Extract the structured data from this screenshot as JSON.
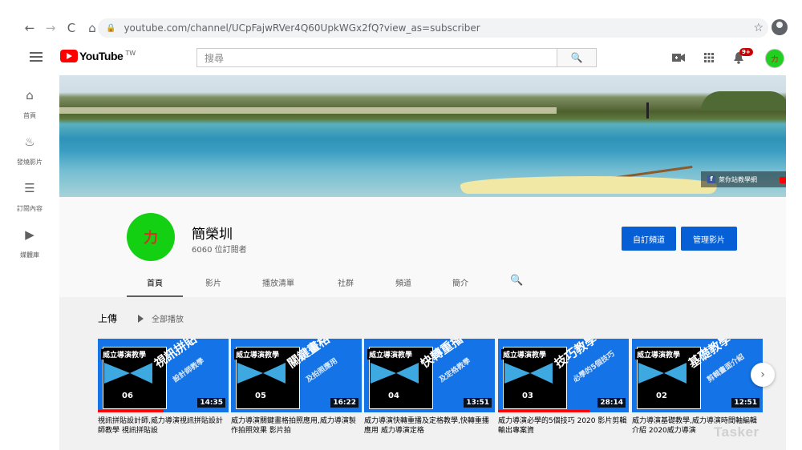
{
  "browser": {
    "url": "youtube.com/channel/UCpFajwRVer4Q60UpkWGx2fQ?view_as=subscriber",
    "back": "←",
    "forward": "→",
    "reload": "C",
    "home": "⌂",
    "star": "☆"
  },
  "header": {
    "logo_text": "YouTube",
    "region": "TW",
    "search_placeholder": "搜尋",
    "notification_count": "9+",
    "avatar_text": "力"
  },
  "sidebar": {
    "items": [
      {
        "label": "首頁",
        "icon": "home-icon",
        "glyph": "⌂"
      },
      {
        "label": "發燒影片",
        "icon": "flame-icon",
        "glyph": "♨"
      },
      {
        "label": "訂閱內容",
        "icon": "subscriptions-icon",
        "glyph": "☰"
      },
      {
        "label": "媒體庫",
        "icon": "library-icon",
        "glyph": "▶"
      }
    ]
  },
  "banner": {
    "link_text": "萊你站教學網"
  },
  "channel": {
    "name": "簡榮圳",
    "subscribers": "6060 位訂閱者",
    "avatar_text": "力",
    "customize_button": "自訂頻道",
    "manage_button": "管理影片",
    "tabs": [
      "首頁",
      "影片",
      "播放清單",
      "社群",
      "頻道",
      "簡介"
    ]
  },
  "uploads": {
    "title": "上傳",
    "play_all": "全部播放",
    "videos": [
      {
        "brand": "威立導演教學",
        "big": "視訊拼貼",
        "small": "設計師教學",
        "num": "06",
        "duration": "14:35",
        "progress": 0.5,
        "title": "視訊拼貼設計師,威力導演視訊拼貼設計師教學 視訊拼貼設"
      },
      {
        "brand": "威立導演教學",
        "big": "關鍵畫格",
        "small": "及拍照應用",
        "num": "05",
        "duration": "16:22",
        "progress": 0.0,
        "title": "威力導演關鍵畫格拍照應用,威力導演製作拍照效果 影片拍"
      },
      {
        "brand": "威立導演教學",
        "big": "快轉重播",
        "small": "及定格教學",
        "num": "04",
        "duration": "13:51",
        "progress": 0.0,
        "title": "威力導演快轉重播及定格教學,快轉重播應用 威力導演定格"
      },
      {
        "brand": "威立導演教學",
        "big": "技巧教學",
        "small": "必學的5個技巧",
        "num": "03",
        "duration": "28:14",
        "progress": 0.7,
        "title": "威力導演必學的5個技巧 2020 影片剪輯 輸出專案資"
      },
      {
        "brand": "威立導演教學",
        "big": "基礎教學",
        "small": "剪輯畫面介紹",
        "num": "02",
        "duration": "12:51",
        "progress": 0.0,
        "title": "威力導演基礎教學,威力導演時間軸編輯介紹 2020威力導演"
      }
    ]
  },
  "watermark": "Tasker"
}
